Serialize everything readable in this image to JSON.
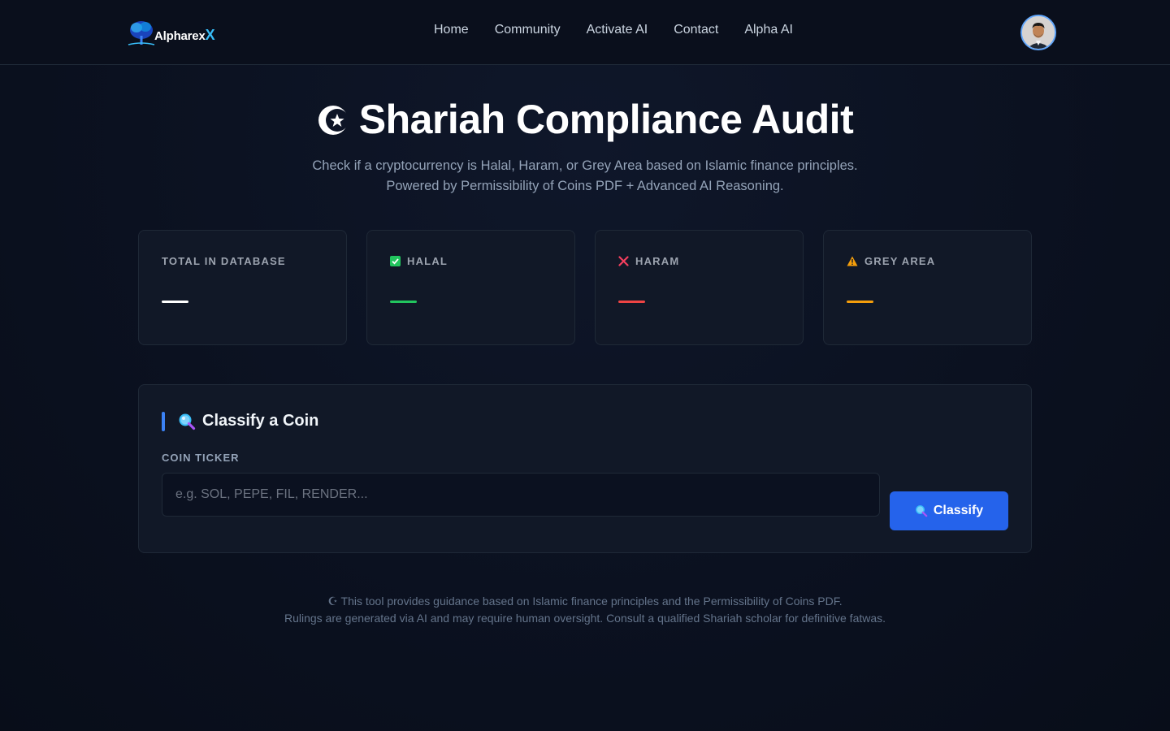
{
  "brand": {
    "name": "Alpharex",
    "accent_suffix": "X"
  },
  "nav": {
    "links": [
      "Home",
      "Community",
      "Activate AI",
      "Contact",
      "Alpha AI"
    ]
  },
  "hero": {
    "title": "Shariah Compliance Audit",
    "subtitle_line1": "Check if a cryptocurrency is Halal, Haram, or Grey Area based on Islamic finance principles.",
    "subtitle_line2": "Powered by Permissibility of Coins PDF + Advanced AI Reasoning."
  },
  "stats": [
    {
      "label": "TOTAL IN DATABASE",
      "value": "—",
      "color": "#ffffff",
      "icon": "none"
    },
    {
      "label": "HALAL",
      "value": "—",
      "color": "#22c55e",
      "icon": "check-box-icon"
    },
    {
      "label": "HARAM",
      "value": "—",
      "color": "#ef4444",
      "icon": "cross-icon"
    },
    {
      "label": "GREY AREA",
      "value": "—",
      "color": "#f59e0b",
      "icon": "warning-icon"
    }
  ],
  "classify": {
    "title": "Classify a Coin",
    "field_label": "COIN TICKER",
    "placeholder": "e.g. SOL, PEPE, FIL, RENDER...",
    "value": "",
    "button_label": "Classify"
  },
  "disclaimer": {
    "line1": "☪ This tool provides guidance based on Islamic finance principles and the Permissibility of Coins PDF.",
    "line2": "Rulings are generated via AI and may require human oversight. Consult a qualified Shariah scholar for definitive fatwas."
  },
  "colors": {
    "accent": "#2563eb",
    "halal": "#22c55e",
    "haram": "#ef4444",
    "grey": "#f59e0b"
  }
}
